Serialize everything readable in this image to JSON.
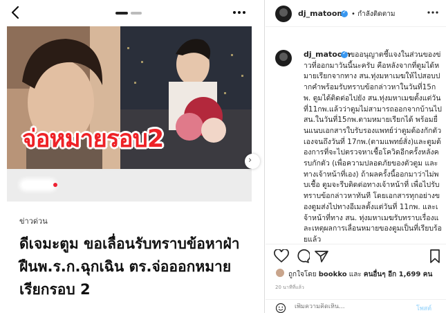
{
  "left_post": {
    "headline_overlay": "จ่อหมายรอบ2",
    "section_label": "ข่าวด่วน",
    "title": "ดีเจมะตูม ขอเลื่อนรับทราบข้อหาฝ่าฝืนพ.ร.ก.ฉุกเฉิน ตร.จ่อออกหมายเรียกรอบ 2",
    "next_glyph": "›"
  },
  "header": {
    "username": "dj_matoom",
    "follow_status": "• กำลังติดตาม"
  },
  "caption": {
    "username": "dj_matoom",
    "text": "ขออนุญาตชี้แจงในส่วนของข่าวที่ออกมาวันนี้นะครับ คือหลังจากที่ตูมได้หมายเรียกจากทาง สน.ทุ่งมหาเมฆให้ไปสอบปากคำพร้อมรับทราบข้อกล่าวหาในวันที่15กพ. ตูมได้ติดต่อไปยัง สน.ทุ่งมหาเมฆตั้งแต่วันที่11กพ.แล้วว่าตูมไม่สามารถออกจากบ้านไป สน.ในวันที่15กพ.ตามหมายเรียกได้ พร้อมยื่นแนบเอกสารใบรับรองแพทย์ว่าตูมต้องกักตัวเองจนถึงวันที่ 17กพ.(ตามแพทย์สั่ง)และตูมต้องการที่จะไปตรวจหาเชื้อโควิดอีกครั้งหลังครบกักตัว (เพื่อความปลอดภัยของตัวตูม และทางเจ้าหน้าที่เอง) ถ้าผลครั้งนี้ออกมาว่าไม่พบเชื้อ ตูมจะรีบติดต่อทางเจ้าหน้าที่ เพื่อไปรับทราบข้อกล่าวหาทันที โดยเอกสารทุกอย่างของตูมส่งไปทางอีเมลตั้งแต่วันที่ 11กพ. และเจ้าหน้าที่ทาง สน. ทุ่งมหาเมฆรับทราบเรื่องและเหตุผลการเลื่อนหมายของตูมเป็นที่เรียบร้อยแล้ว"
  },
  "likes": {
    "prefix": "ถูกใจโดย ",
    "liker": "bookko",
    "middle": " และ ",
    "others": "คนอื่นๆ อีก 1,699 คน"
  },
  "timestamp": "20 นาทีที่แล้ว",
  "comment": {
    "placeholder": "เพิ่มความคิดเห็น...",
    "post_label": "โพสต์"
  },
  "icons": {
    "back": "chevron-left-icon",
    "more": "more-horizontal-icon",
    "like": "heart-icon",
    "comment": "comment-bubble-icon",
    "share": "paper-plane-icon",
    "save": "bookmark-icon",
    "emoji": "smiley-icon"
  },
  "colors": {
    "headline_red": "#ee2227",
    "verified_blue": "#3897f0",
    "post_button": "#b2dffc"
  }
}
